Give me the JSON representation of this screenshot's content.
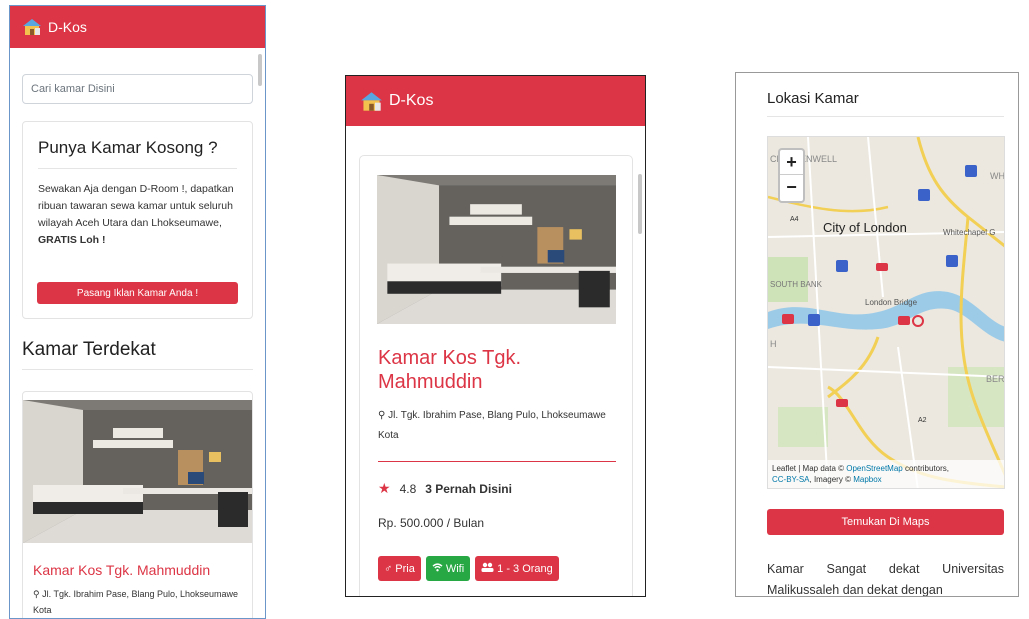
{
  "colors": {
    "brand_red": "#dc3545",
    "badge_green": "#28a745"
  },
  "phone1": {
    "brand": "D-Kos",
    "search_placeholder": "Cari kamar Disini",
    "promo": {
      "title": "Punya Kamar Kosong ?",
      "text": "Sewakan Aja dengan D-Room !, dapatkan ribuan tawaran sewa kamar untuk seluruh wilayah Aceh Utara dan Lhokseumawe,",
      "text_bold": "GRATIS Loh !",
      "button": "Pasang Iklan Kamar Anda !"
    },
    "section_title": "Kamar Terdekat",
    "card": {
      "title": "Kamar Kos Tgk. Mahmuddin",
      "address": "Jl. Tgk. Ibrahim Pase, Blang Pulo, Lhokseumawe Kota"
    }
  },
  "phone2": {
    "brand": "D-Kos",
    "card": {
      "title": "Kamar Kos Tgk. Mahmuddin",
      "address": "Jl. Tgk. Ibrahim Pase, Blang Pulo, Lhokseumawe Kota",
      "rating": "4.8",
      "visits": "3 Pernah Disini",
      "price": "Rp. 500.000 / Bulan",
      "badges": [
        {
          "icon": "male-icon",
          "label": "Pria"
        },
        {
          "icon": "wifi-icon",
          "label": "Wifi"
        },
        {
          "icon": "users-icon",
          "label": "1 - 3 Orang"
        }
      ]
    }
  },
  "phone3": {
    "heading": "Lokasi Kamar",
    "map": {
      "zoom_in": "+",
      "zoom_out": "−",
      "labels": {
        "city": "City of London",
        "whitechapel": "Whitechapel G",
        "london_bridge": "London Bridge",
        "south_bank": "SOUTH BANK",
        "clerkenwell": "CLERKENWELL",
        "a4": "A4",
        "a2": "A2",
        "wh": "WH",
        "ber": "BER",
        "h": "H"
      },
      "attribution_1": "Leaflet | Map data ©",
      "attribution_link1": "OpenStreetMap",
      "attribution_2": "contributors,",
      "attribution_link2": "CC-BY-SA",
      "attribution_3": ", Imagery ©",
      "attribution_link3": "Mapbox"
    },
    "maps_button": "Temukan Di Maps",
    "description": "Kamar Sangat dekat Universitas Malikussaleh dan dekat dengan"
  }
}
